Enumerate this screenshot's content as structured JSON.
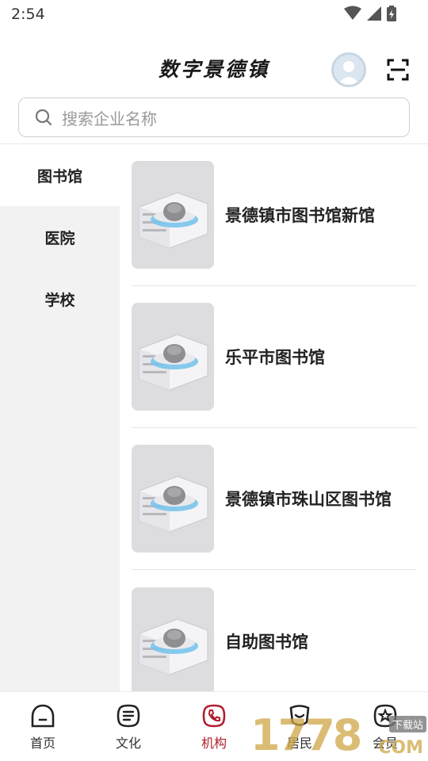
{
  "status_bar": {
    "time": "2:54"
  },
  "header": {
    "title": "数字景德镇"
  },
  "search": {
    "placeholder": "搜索企业名称"
  },
  "sidebar": {
    "items": [
      {
        "label": "图书馆",
        "active": true
      },
      {
        "label": "医院",
        "active": false
      },
      {
        "label": "学校",
        "active": false
      }
    ]
  },
  "libraries": [
    {
      "name": "景德镇市图书馆新馆"
    },
    {
      "name": "乐平市图书馆"
    },
    {
      "name": "景德镇市珠山区图书馆"
    },
    {
      "name": "自助图书馆"
    }
  ],
  "tabbar": {
    "tabs": [
      {
        "label": "首页",
        "icon": "home-face-icon"
      },
      {
        "label": "文化",
        "icon": "culture-lines-icon"
      },
      {
        "label": "机构",
        "icon": "institution-phone-icon",
        "active": true
      },
      {
        "label": "居民",
        "icon": "resident-icon"
      },
      {
        "label": "会员",
        "icon": "member-star-icon"
      }
    ]
  },
  "watermark": {
    "digits": "1778",
    "tag": "下载站",
    "suffix": "COM"
  },
  "colors": {
    "accent": "#b01e2e",
    "sidebar_bg": "#f2f2f2",
    "card_border": "#e6e6e6"
  }
}
